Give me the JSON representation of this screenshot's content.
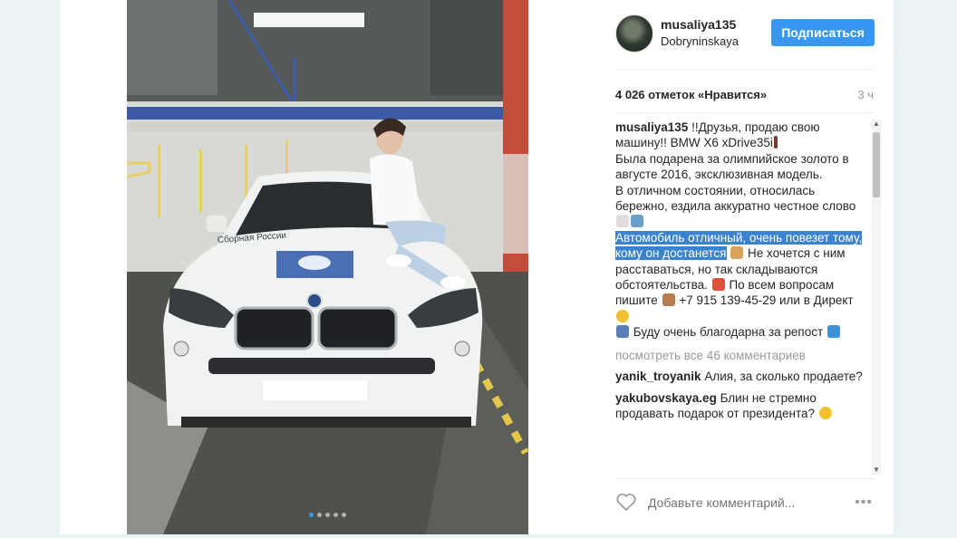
{
  "post": {
    "username": "musaliya135",
    "location": "Dobryninskaya",
    "follow_label": "Подписаться",
    "likes": "4 026 отметок «Нравится»",
    "time": "3 ч",
    "caption": {
      "author": "musaliya135",
      "part1": "!!Друзья, продаю свою машину!! BMW X6 xDrive35i",
      "part2": "Была подарена за олимпийское золото в августе 2016, эксклюзивная модель.",
      "part3": "В отличном состоянии, относилась бережно, ездила аккуратно честное слово",
      "highlight": "Автомобиль отличный, очень повезет тому, кому он достанется",
      "part4": "Не хочется с ним расставаться, но так складываются обстоятельства.",
      "part5": "По всем вопросам пишите",
      "phone": "+7 915 139-45-29 или в Директ",
      "part6": "Буду очень благодарна за репост"
    },
    "view_all": "посмотреть все 46 комментариев",
    "comments": [
      {
        "user": "yanik_troyanik",
        "text": "Алия, за сколько продаете?"
      },
      {
        "user": "yakubovskaya.eg",
        "text": "Блин не стремно продавать подарок от президента?"
      }
    ],
    "comment_placeholder": "Добавьте комментарий...",
    "more_label": "•••",
    "photo_dots": 5,
    "active_dot": 1
  },
  "colors": {
    "accent": "#3897f0",
    "highlight": "#3b83d1",
    "muted": "#999999"
  },
  "icons": [
    "heart-icon",
    "more-options-icon",
    "scroll-up-arrow",
    "scroll-down-arrow"
  ]
}
